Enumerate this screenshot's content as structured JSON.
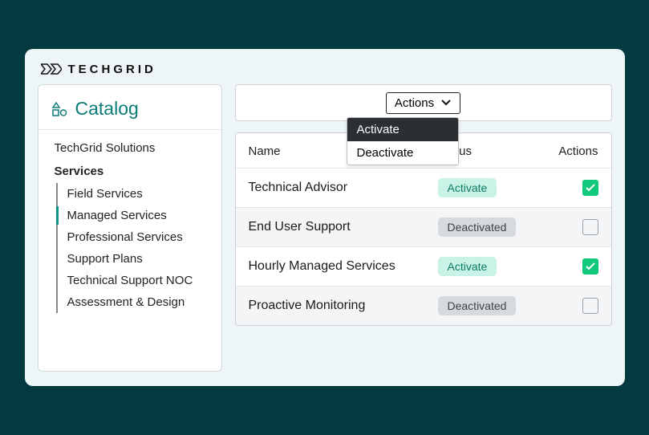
{
  "brand": {
    "name": "TECHGRID"
  },
  "sidebar": {
    "catalog_label": "Catalog",
    "item_solutions": "TechGrid Solutions",
    "item_services": "Services",
    "sub_items": [
      {
        "label": "Field Services"
      },
      {
        "label": "Managed Services"
      },
      {
        "label": "Professional Services"
      },
      {
        "label": "Support Plans"
      },
      {
        "label": "Technical Support NOC"
      },
      {
        "label": "Assessment & Design"
      }
    ]
  },
  "actions": {
    "button_label": "Actions",
    "dropdown": {
      "activate": "Activate",
      "deactivate": "Deactivate"
    }
  },
  "table": {
    "headers": {
      "name": "Name",
      "status": "Status",
      "actions": "Actions"
    },
    "rows": [
      {
        "name": "Technical Advisor",
        "status": "Activate",
        "status_class": "activate",
        "checked": true
      },
      {
        "name": "End User Support",
        "status": "Deactivated",
        "status_class": "deactivated",
        "checked": false
      },
      {
        "name": "Hourly Managed Services",
        "status": "Activate",
        "status_class": "activate",
        "checked": true
      },
      {
        "name": "Proactive Monitoring",
        "status": "Deactivated",
        "status_class": "deactivated",
        "checked": false
      }
    ]
  }
}
